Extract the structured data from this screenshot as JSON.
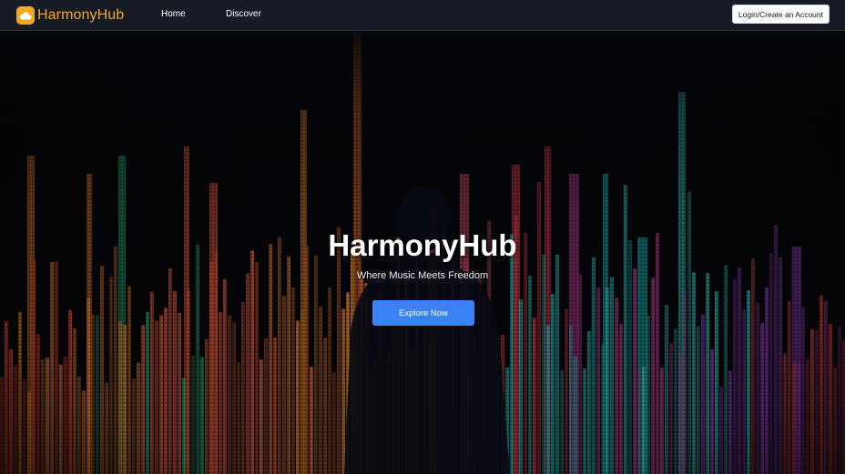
{
  "navbar": {
    "brand_name": "HarmonyHub",
    "brand_icon": "cloud-icon",
    "links": [
      "Home",
      "Discover"
    ],
    "login_label": "Login/Create an Account"
  },
  "hero": {
    "title": "HarmonyHub",
    "subtitle": "Where Music Meets Freedom",
    "cta_label": "Explore Now"
  },
  "colors": {
    "brand": "#f5a623",
    "navbar_bg": "#161b26",
    "cta": "#3b82f6",
    "hero_bg": "#05060a"
  }
}
